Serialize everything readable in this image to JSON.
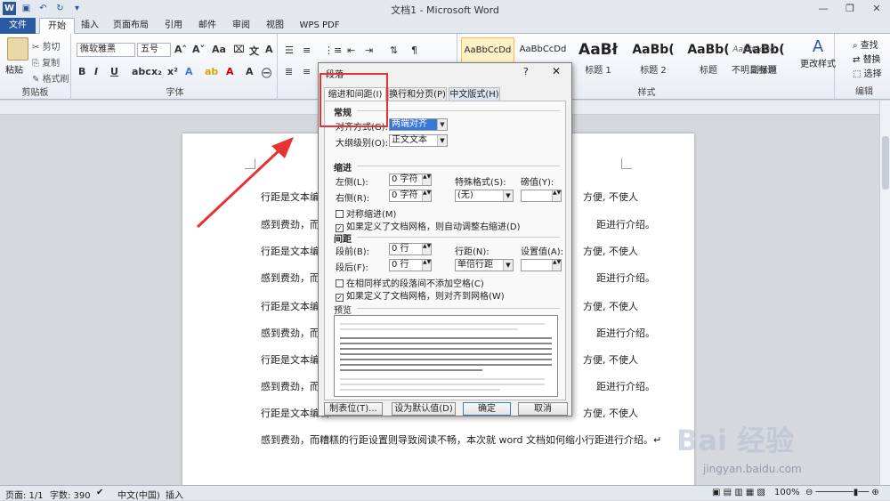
{
  "window": {
    "title": "文档1 - Microsoft Word"
  },
  "tabs": [
    "文件",
    "开始",
    "插入",
    "页面布局",
    "引用",
    "邮件",
    "审阅",
    "视图",
    "WPS PDF"
  ],
  "ribbon": {
    "clipboard": {
      "paste": "粘贴",
      "cut": "剪切",
      "copy": "复制",
      "format_painter": "格式刷",
      "label": "剪贴板"
    },
    "font": {
      "name": "微软雅黑",
      "size": "五号",
      "label": "字体"
    },
    "paragraph": {
      "label": ""
    },
    "styles": {
      "items": [
        {
          "preview": "AaBbCcDd",
          "name": ""
        },
        {
          "preview": "AaBbCcDd",
          "name": ""
        },
        {
          "preview": "AaBł",
          "name": "标题 1"
        },
        {
          "preview": "AaBb(",
          "name": "标题 2"
        },
        {
          "preview": "AaBb(",
          "name": "标题"
        },
        {
          "preview": "AaBb(",
          "name": "副标题"
        },
        {
          "preview": "AaBbCcDd",
          "name": "不明显强调"
        }
      ],
      "change": "更改样式",
      "label": "样式"
    },
    "editing": {
      "find": "查找",
      "replace": "替换",
      "select": "选择",
      "label": "编辑"
    }
  },
  "document": {
    "lines_a": "行距是文本编辑",
    "lines_a_tail": "方便, 不使人",
    "lines_b": "感到费劲，而糟",
    "lines_b_tail": "距进行介绍。",
    "last": "感到费劲，而糟糕的行距设置则导致阅读不畅，本次就 word 文档如何缩小行距进行介绍。↵"
  },
  "dialog": {
    "title": "段落",
    "help": "?",
    "close": "✕",
    "tabs": [
      "缩进和间距(I)",
      "换行和分页(P)",
      "中文版式(H)"
    ],
    "general": {
      "heading": "常规",
      "align_label": "对齐方式(G):",
      "align_value": "两端对齐",
      "outline_label": "大纲级别(O):",
      "outline_value": "正文文本"
    },
    "indent": {
      "heading": "缩进",
      "left_label": "左侧(L):",
      "left_value": "0 字符",
      "right_label": "右侧(R):",
      "right_value": "0 字符",
      "special_label": "特殊格式(S):",
      "special_value": "(无)",
      "by_label": "磅值(Y):",
      "by_value": "",
      "mirror": "对称缩进(M)",
      "auto": "如果定义了文档网格，则自动调整右缩进(D)"
    },
    "spacing": {
      "heading": "间距",
      "before_label": "段前(B):",
      "before_value": "0 行",
      "after_label": "段后(F):",
      "after_value": "0 行",
      "line_label": "行距(N):",
      "line_value": "单倍行距",
      "at_label": "设置值(A):",
      "at_value": "",
      "nospace": "在相同样式的段落间不添加空格(C)",
      "grid": "如果定义了文档网格，则对齐到网格(W)"
    },
    "preview": {
      "heading": "预览"
    },
    "buttons": {
      "tabs": "制表位(T)...",
      "default": "设为默认值(D)",
      "ok": "确定",
      "cancel": "取消"
    }
  },
  "status": {
    "page": "页面: 1/1",
    "words": "字数: 390",
    "lang": "中文(中国)",
    "mode": "插入",
    "zoom": "100%"
  },
  "watermark": {
    "logo": "Bai 经验",
    "url": "jingyan.baidu.com"
  },
  "colors": {
    "accent": "#2b579a",
    "highlight": "#e53333",
    "arrow": "#e53333"
  }
}
